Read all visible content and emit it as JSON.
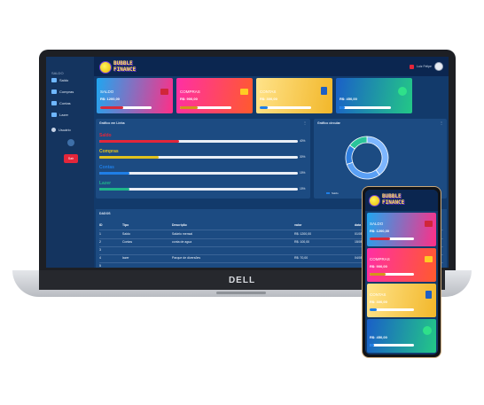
{
  "brand": {
    "line1": "BUBBLE",
    "line2": "FINANCE"
  },
  "sidebar": {
    "title": "SALDO",
    "items": [
      {
        "label": "Saldo",
        "color": "#6fb7ff"
      },
      {
        "label": "Compras",
        "color": "#6fb7ff"
      },
      {
        "label": "Contas",
        "color": "#6fb7ff"
      },
      {
        "label": "Lazer",
        "color": "#6fb7ff"
      },
      {
        "label": "Usuário",
        "color": "#c7d3e6"
      }
    ],
    "exit_label": "Sair"
  },
  "header": {
    "user_label": "Luiz Felipe"
  },
  "cards": [
    {
      "name": "saldo",
      "label": "SALDO",
      "value": "R$: 1200,00",
      "progress": 0.45,
      "gradient": [
        "#1fa6f0",
        "#ff2f87"
      ],
      "bar_color": "#d82a3c",
      "icon_color": "#d0263a"
    },
    {
      "name": "compras",
      "label": "COMPRAS",
      "value": "R$: 900,00",
      "progress": 0.35,
      "gradient": [
        "#ff2fa5",
        "#ff5a2d"
      ],
      "bar_color": "#d4951a",
      "icon_color": "#ffcb24"
    },
    {
      "name": "contas",
      "label": "CONTAS",
      "value": "R$: 300,00",
      "progress": 0.15,
      "gradient": [
        "#ffe38a",
        "#f2b72a"
      ],
      "bar_color": "#1f7ee6",
      "icon_color": "#1e5fc4"
    },
    {
      "name": "lazer",
      "label": "",
      "value": "R$: 450,00",
      "progress": 0.1,
      "gradient": [
        "#1a5fc8",
        "#23c886"
      ],
      "bar_color": "#1f7ee6",
      "icon_color": "#2fe08a"
    }
  ],
  "line_chart_panel": {
    "title": "Gráfico em Linha",
    "menu": "⋮",
    "rows": [
      {
        "label": "Saldo",
        "percent": 40,
        "pct_text": "40%",
        "color": "#e3263a"
      },
      {
        "label": "Compras",
        "percent": 30,
        "pct_text": "30%",
        "color": "#e0c21e"
      },
      {
        "label": "Contas",
        "percent": 15,
        "pct_text": "15%",
        "color": "#1f7ee6"
      },
      {
        "label": "Lazer",
        "percent": 15,
        "pct_text": "15%",
        "color": "#1fb48a"
      }
    ]
  },
  "donut_panel": {
    "title": "Gráfico circular",
    "menu": "⋮",
    "legend": [
      {
        "label": "Saldo",
        "color": "#1f7ee6"
      }
    ],
    "slices": [
      {
        "value": 40,
        "color": "#7db6ff"
      },
      {
        "value": 30,
        "color": "#5aa0f5"
      },
      {
        "value": 15,
        "color": "#2f7fe0"
      },
      {
        "value": 15,
        "color": "#2bc49a"
      }
    ]
  },
  "table": {
    "title": "DADOS",
    "headers": [
      "ID",
      "Tipo",
      "Descrição",
      "valor",
      "data"
    ],
    "rows": [
      [
        "1",
        "Saldo",
        "Salário mensal",
        "R$: 1200,00",
        "01/05/21"
      ],
      [
        "2",
        "Contas",
        "conta de agua",
        "R$: 100,00",
        "15/05/21"
      ],
      [
        "3",
        "",
        "",
        "",
        ""
      ],
      [
        "4",
        "lazer",
        "Parque de diversões",
        "R$: 70,00",
        "04/05/21"
      ],
      [
        "5",
        "",
        "",
        "",
        ""
      ]
    ]
  },
  "laptop_brand": "DELL"
}
